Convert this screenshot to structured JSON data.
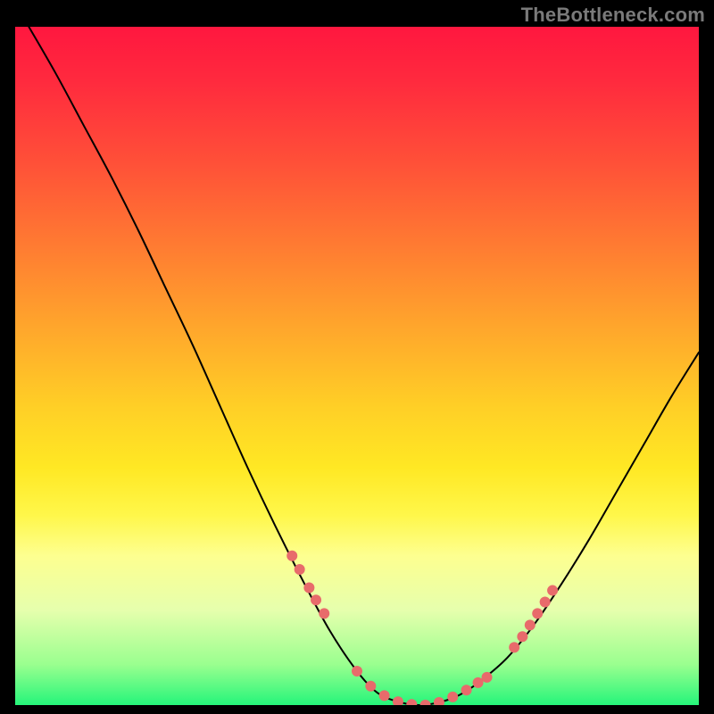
{
  "watermark": "TheBottleneck.com",
  "colors": {
    "background_frame": "#000000",
    "gradient_top": "#ff173f",
    "gradient_bottom": "#25f57a",
    "curve_stroke": "#000000",
    "marker_fill": "#e86b6b"
  },
  "chart_data": {
    "type": "line",
    "title": "",
    "xlabel": "",
    "ylabel": "",
    "xlim": [
      0,
      100
    ],
    "ylim": [
      0,
      100
    ],
    "series": [
      {
        "name": "bottleneck-curve",
        "x": [
          2,
          6,
          10,
          14,
          18,
          22,
          26,
          30,
          34,
          38,
          42,
          46,
          50,
          53,
          56,
          59,
          62,
          65,
          68,
          72,
          76,
          80,
          84,
          88,
          92,
          96,
          100
        ],
        "y": [
          100,
          93,
          85.5,
          78,
          70,
          61.5,
          53,
          44,
          35,
          26.5,
          18.5,
          11,
          5,
          1.8,
          0.5,
          0,
          0.4,
          1.5,
          3.5,
          7,
          12,
          18,
          24.5,
          31.5,
          38.5,
          45.5,
          52
        ]
      }
    ],
    "markers": {
      "name": "highlight-points",
      "x": [
        40.5,
        41.6,
        43,
        44,
        45.2,
        50,
        52,
        54,
        56,
        58,
        60,
        62,
        64,
        66,
        67.7,
        69,
        73,
        74.2,
        75.3,
        76.4,
        77.5,
        78.6
      ],
      "y": [
        22,
        20,
        17.3,
        15.5,
        13.5,
        5,
        2.8,
        1.4,
        0.5,
        0.1,
        0,
        0.4,
        1.2,
        2.2,
        3.3,
        4.1,
        8.5,
        10.1,
        11.8,
        13.5,
        15.2,
        16.9
      ]
    }
  }
}
